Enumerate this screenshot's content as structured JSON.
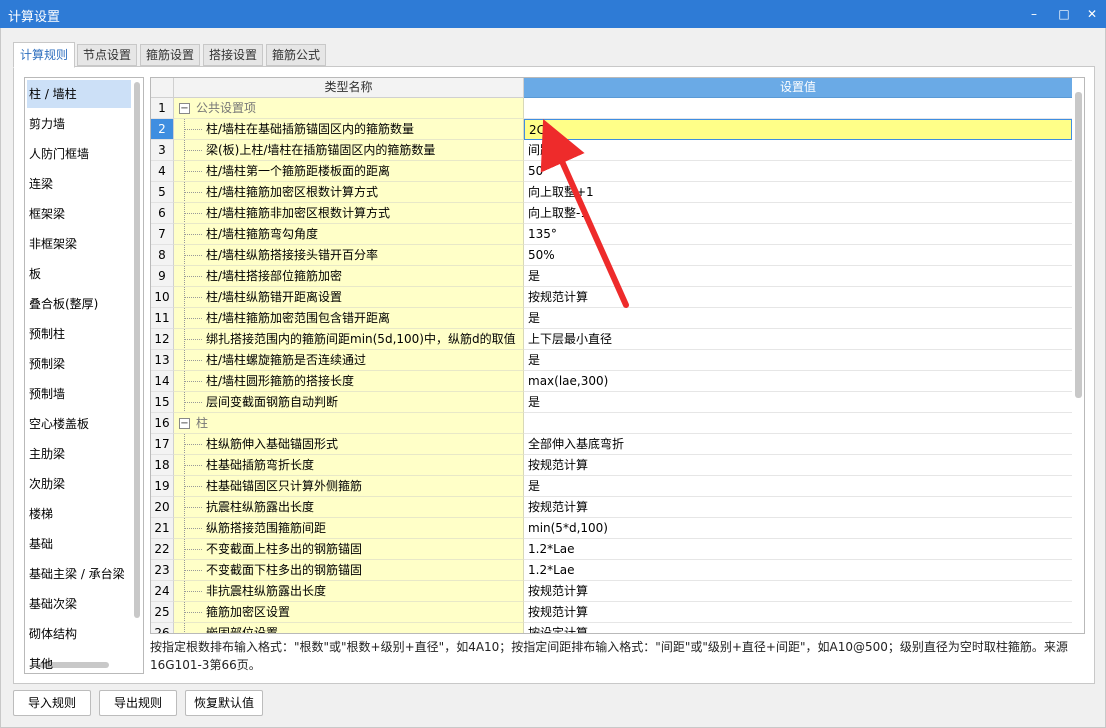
{
  "window": {
    "title": "计算设置",
    "minimize": "–",
    "maximize": "□",
    "close": "✕"
  },
  "tabs": [
    "计算规则",
    "节点设置",
    "箍筋设置",
    "搭接设置",
    "箍筋公式"
  ],
  "sidebar": {
    "items": [
      "柱 / 墙柱",
      "剪力墙",
      "人防门框墙",
      "连梁",
      "框架梁",
      "非框架梁",
      "板",
      "叠合板(整厚)",
      "预制柱",
      "预制梁",
      "预制墙",
      "空心楼盖板",
      "主肋梁",
      "次肋梁",
      "楼梯",
      "基础",
      "基础主梁 / 承台梁",
      "基础次梁",
      "砌体结构",
      "其他"
    ]
  },
  "grid": {
    "columns": {
      "name": "类型名称",
      "value": "设置值"
    },
    "rows": [
      {
        "num": "1",
        "name": "公共设置项",
        "value": "",
        "group": true
      },
      {
        "num": "2",
        "name": "柱/墙柱在基础插筋锚固区内的箍筋数量",
        "value": "2C8",
        "current": true
      },
      {
        "num": "3",
        "name": "梁(板)上柱/墙柱在插筋锚固区内的箍筋数量",
        "value": "间距500"
      },
      {
        "num": "4",
        "name": "柱/墙柱第一个箍筋距楼板面的距离",
        "value": "50"
      },
      {
        "num": "5",
        "name": "柱/墙柱箍筋加密区根数计算方式",
        "value": "向上取整+1"
      },
      {
        "num": "6",
        "name": "柱/墙柱箍筋非加密区根数计算方式",
        "value": "向上取整-1"
      },
      {
        "num": "7",
        "name": "柱/墙柱箍筋弯勾角度",
        "value": "135°"
      },
      {
        "num": "8",
        "name": "柱/墙柱纵筋搭接接头错开百分率",
        "value": "50%"
      },
      {
        "num": "9",
        "name": "柱/墙柱搭接部位箍筋加密",
        "value": "是"
      },
      {
        "num": "10",
        "name": "柱/墙柱纵筋错开距离设置",
        "value": "按规范计算"
      },
      {
        "num": "11",
        "name": "柱/墙柱箍筋加密范围包含错开距离",
        "value": "是"
      },
      {
        "num": "12",
        "name": "绑扎搭接范围内的箍筋间距min(5d,100)中，纵筋d的取值",
        "value": "上下层最小直径"
      },
      {
        "num": "13",
        "name": "柱/墙柱螺旋箍筋是否连续通过",
        "value": "是"
      },
      {
        "num": "14",
        "name": "柱/墙柱圆形箍筋的搭接长度",
        "value": "max(lae,300)"
      },
      {
        "num": "15",
        "name": "层间变截面钢筋自动判断",
        "value": "是"
      },
      {
        "num": "16",
        "name": "柱",
        "value": "",
        "group": true
      },
      {
        "num": "17",
        "name": "柱纵筋伸入基础锚固形式",
        "value": "全部伸入基底弯折"
      },
      {
        "num": "18",
        "name": "柱基础插筋弯折长度",
        "value": "按规范计算"
      },
      {
        "num": "19",
        "name": "柱基础锚固区只计算外侧箍筋",
        "value": "是"
      },
      {
        "num": "20",
        "name": "抗震柱纵筋露出长度",
        "value": "按规范计算"
      },
      {
        "num": "21",
        "name": "纵筋搭接范围箍筋间距",
        "value": "min(5*d,100)"
      },
      {
        "num": "22",
        "name": "不变截面上柱多出的钢筋锚固",
        "value": "1.2*Lae"
      },
      {
        "num": "23",
        "name": "不变截面下柱多出的钢筋锚固",
        "value": "1.2*Lae"
      },
      {
        "num": "24",
        "name": "非抗震柱纵筋露出长度",
        "value": "按规范计算"
      },
      {
        "num": "25",
        "name": "箍筋加密区设置",
        "value": "按规范计算"
      },
      {
        "num": "26",
        "name": "嵌固部位设置",
        "value": "按设定计算"
      }
    ]
  },
  "hint": "按指定根数排布输入格式：\"根数\"或\"根数+级别+直径\"，如4A10；按指定间距排布输入格式：\"间距\"或\"级别+直径+间距\"，如A10@500；级别直径为空时取柱箍筋。来源16G101-3第66页。",
  "buttons": {
    "import": "导入规则",
    "export": "导出规则",
    "reset": "恢复默认值"
  },
  "colors": {
    "titlebar": "#2e7bd6",
    "header_value": "#6aaae6",
    "name_cell": "#ffffc8",
    "current_value": "#ffff88",
    "arrow": "#ee2b2b"
  }
}
